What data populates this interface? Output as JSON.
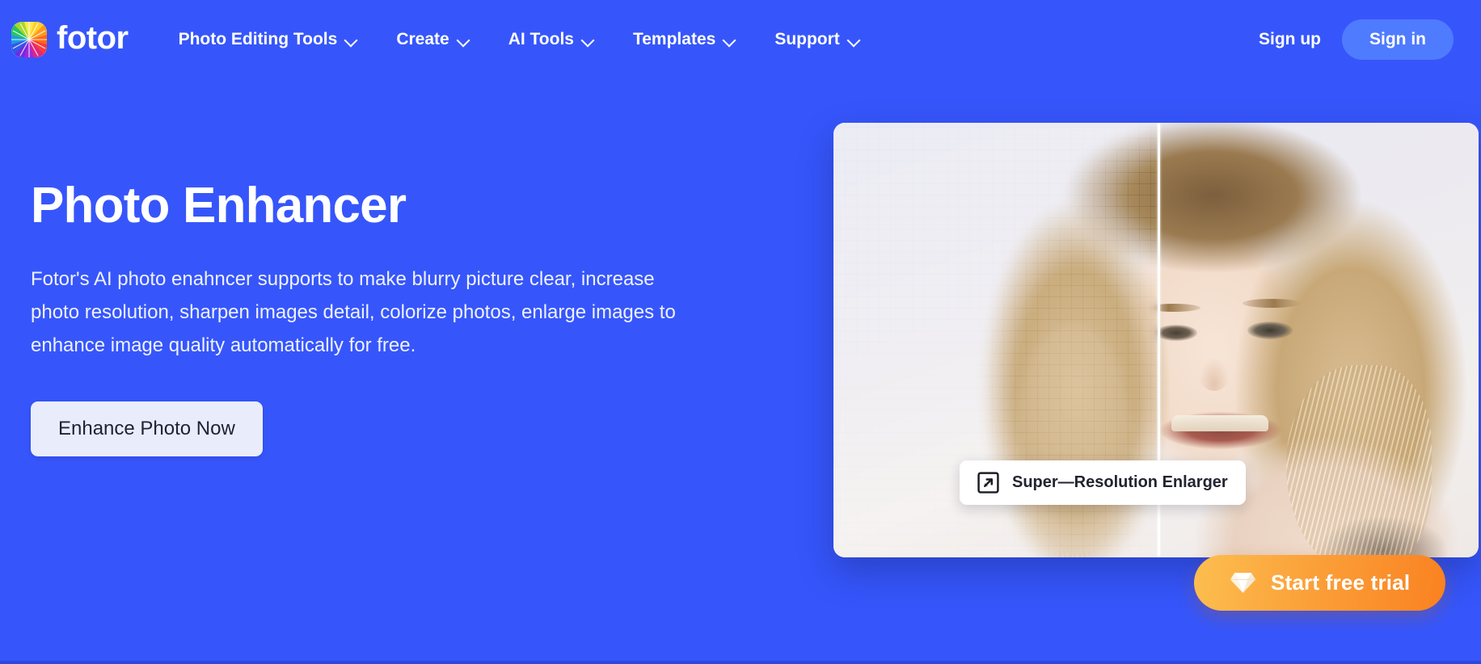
{
  "theme": {
    "brand_blue": "#3656fb",
    "signin_blue": "#4f7bff",
    "cta_light": "#e9edfb",
    "cta_text": "#1d2235",
    "trial_gradient_from": "#fcbf4f",
    "trial_gradient_to": "#fa8120",
    "text_white": "#ffffff"
  },
  "header": {
    "brand_name": "fotor",
    "logo_icon": "color-wheel-icon",
    "nav": [
      {
        "label": "Photo Editing Tools",
        "has_dropdown": true,
        "caret_icon": "chevron-down-icon"
      },
      {
        "label": "Create",
        "has_dropdown": true,
        "caret_icon": "chevron-down-icon"
      },
      {
        "label": "AI Tools",
        "has_dropdown": true,
        "caret_icon": "chevron-down-icon"
      },
      {
        "label": "Templates",
        "has_dropdown": true,
        "caret_icon": "chevron-down-icon"
      },
      {
        "label": "Support",
        "has_dropdown": true,
        "caret_icon": "chevron-down-icon"
      }
    ],
    "sign_up_label": "Sign up",
    "sign_in_label": "Sign in"
  },
  "hero": {
    "title": "Photo Enhancer",
    "description": "Fotor's AI photo enahncer supports to make blurry picture clear, increase photo resolution, sharpen images detail, colorize photos, enlarge images to enhance image quality automatically for free.",
    "cta_label": "Enhance Photo Now"
  },
  "media": {
    "comparison_chip_label": "Super—Resolution Enlarger",
    "comparison_chip_icon": "expand-arrow-icon",
    "slider_handle": "before-after-divider",
    "before_side": "blurry-pixelated",
    "after_side": "sharp-enhanced"
  },
  "floating": {
    "trial_label": "Start free trial",
    "trial_icon": "diamond-gem-icon"
  }
}
